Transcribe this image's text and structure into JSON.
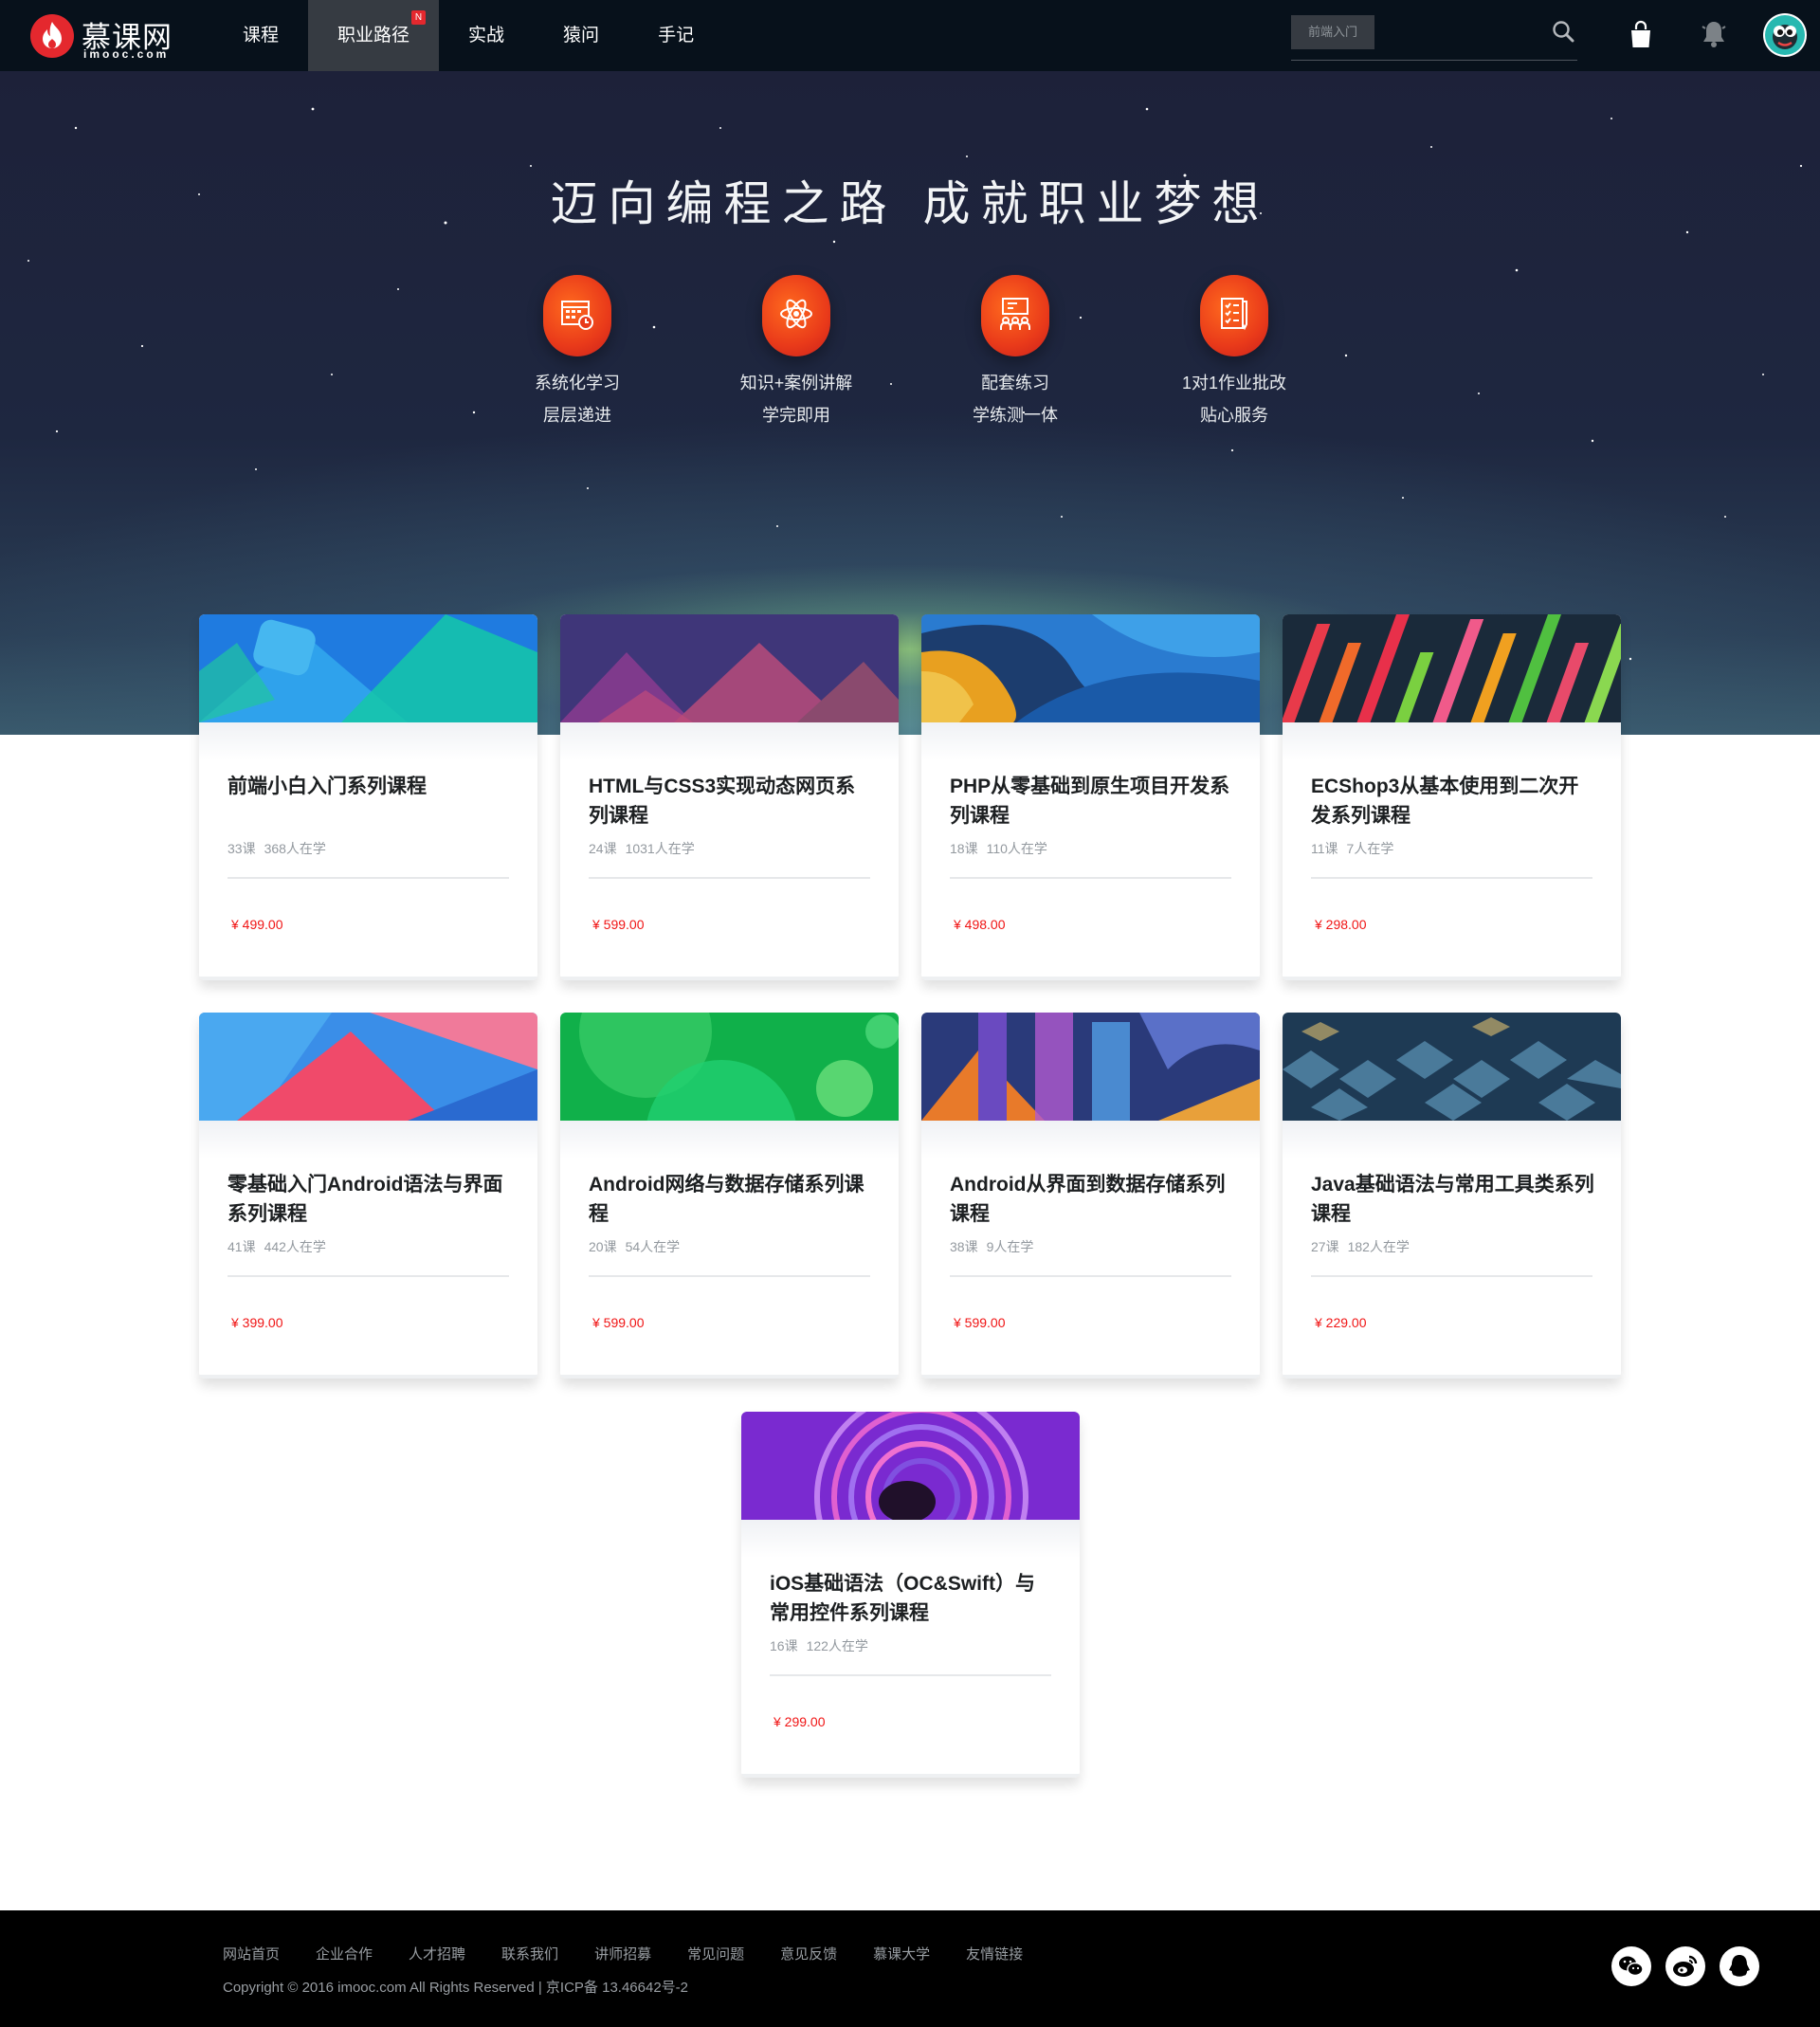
{
  "header": {
    "logo_text": "慕课网",
    "logo_domain": "imooc.com",
    "nav": [
      {
        "label": "课程"
      },
      {
        "label": "职业路径",
        "badge": "N",
        "active": true
      },
      {
        "label": "实战"
      },
      {
        "label": "猿问"
      },
      {
        "label": "手记"
      }
    ],
    "search_tag": "前端入门",
    "icons": [
      "search-icon",
      "shopping-bag-icon",
      "bell-icon",
      "avatar"
    ]
  },
  "hero": {
    "title": "迈向编程之路 成就职业梦想",
    "features": [
      {
        "line1": "系统化学习",
        "line2": "层层递进",
        "icon": "calendar-icon"
      },
      {
        "line1": "知识+案例讲解",
        "line2": "学完即用",
        "icon": "atom-icon"
      },
      {
        "line1": "配套练习",
        "line2": "学练测一体",
        "icon": "classroom-icon"
      },
      {
        "line1": "1对1作业批改",
        "line2": "贴心服务",
        "icon": "checklist-icon"
      }
    ]
  },
  "courses": [
    {
      "title": "前端小白入门系列课程",
      "lessons": "33课",
      "students": "368人在学",
      "price": "¥ 499.00"
    },
    {
      "title": "HTML与CSS3实现动态网页系列课程",
      "lessons": "24课",
      "students": "1031人在学",
      "price": "¥ 599.00"
    },
    {
      "title": "PHP从零基础到原生项目开发系列课程",
      "lessons": "18课",
      "students": "110人在学",
      "price": "¥ 498.00"
    },
    {
      "title": "ECShop3从基本使用到二次开发系列课程",
      "lessons": "11课",
      "students": "7人在学",
      "price": "¥ 298.00"
    },
    {
      "title": "零基础入门Android语法与界面系列课程",
      "lessons": "41课",
      "students": "442人在学",
      "price": "¥ 399.00"
    },
    {
      "title": "Android网络与数据存储系列课程",
      "lessons": "20课",
      "students": "54人在学",
      "price": "¥ 599.00"
    },
    {
      "title": "Android从界面到数据存储系列课程",
      "lessons": "38课",
      "students": "9人在学",
      "price": "¥ 599.00"
    },
    {
      "title": "Java基础语法与常用工具类系列课程",
      "lessons": "27课",
      "students": "182人在学",
      "price": "¥ 229.00"
    },
    {
      "title": "iOS基础语法（OC&Swift）与常用控件系列课程",
      "lessons": "16课",
      "students": "122人在学",
      "price": "¥ 299.00"
    }
  ],
  "footer": {
    "links": [
      "网站首页",
      "企业合作",
      "人才招聘",
      "联系我们",
      "讲师招募",
      "常见问题",
      "意见反馈",
      "慕课大学",
      "友情链接"
    ],
    "copyright": "Copyright © 2016 imooc.com All Rights Reserved | 京ICP备 13.46642号-2",
    "social": [
      "wechat-icon",
      "weibo-icon",
      "qq-icon"
    ]
  },
  "colors": {
    "header_bg": "#07111b",
    "accent": "#f01414",
    "brand_red": "#e4282e",
    "footer_bg": "#000000"
  }
}
